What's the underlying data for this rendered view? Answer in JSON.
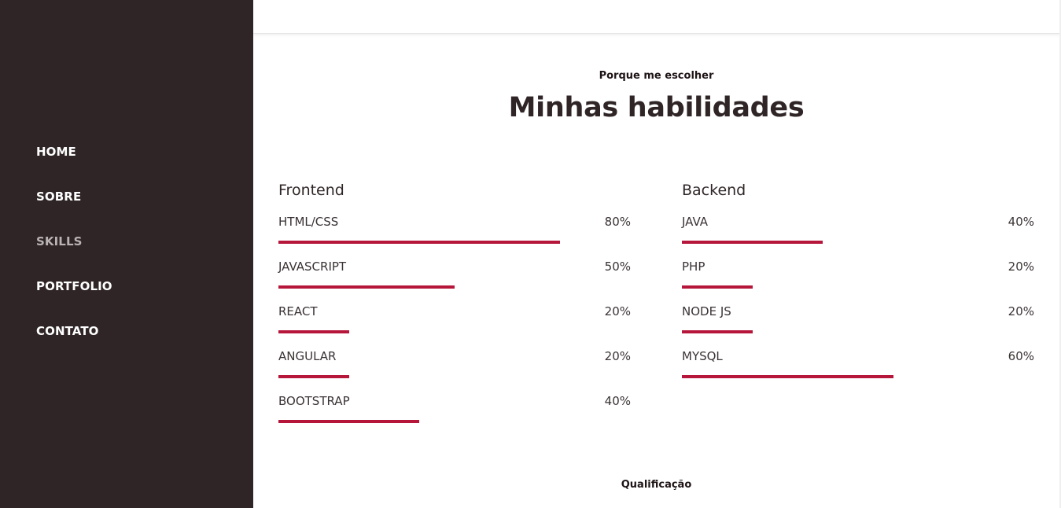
{
  "nav": {
    "items": [
      {
        "label": "HOME",
        "active": false
      },
      {
        "label": "SOBRE",
        "active": false
      },
      {
        "label": "SKILLS",
        "active": true
      },
      {
        "label": "PORTFOLIO",
        "active": false
      },
      {
        "label": "CONTATO",
        "active": false
      }
    ]
  },
  "section": {
    "subtitle": "Porque me escolher",
    "title": "Minhas habilidades"
  },
  "frontend": {
    "title": "Frontend",
    "skills": [
      {
        "name": "HTML/CSS",
        "percent_label": "80%",
        "level": 80
      },
      {
        "name": "JAVASCRIPT",
        "percent_label": "50%",
        "level": 50
      },
      {
        "name": "REACT",
        "percent_label": "20%",
        "level": 20
      },
      {
        "name": "ANGULAR",
        "percent_label": "20%",
        "level": 20
      },
      {
        "name": "BOOTSTRAP",
        "percent_label": "40%",
        "level": 40
      }
    ]
  },
  "backend": {
    "title": "Backend",
    "skills": [
      {
        "name": "JAVA",
        "percent_label": "40%",
        "level": 40
      },
      {
        "name": "PHP",
        "percent_label": "20%",
        "level": 20
      },
      {
        "name": "NODE JS",
        "percent_label": "20%",
        "level": 20
      },
      {
        "name": "MYSQL",
        "percent_label": "60%",
        "level": 60
      }
    ]
  },
  "next_section": {
    "subtitle": "Qualificação"
  },
  "colors": {
    "sidebar": "#2f2526",
    "accent": "#b5163a",
    "nav_active": "#b9b3b4"
  }
}
